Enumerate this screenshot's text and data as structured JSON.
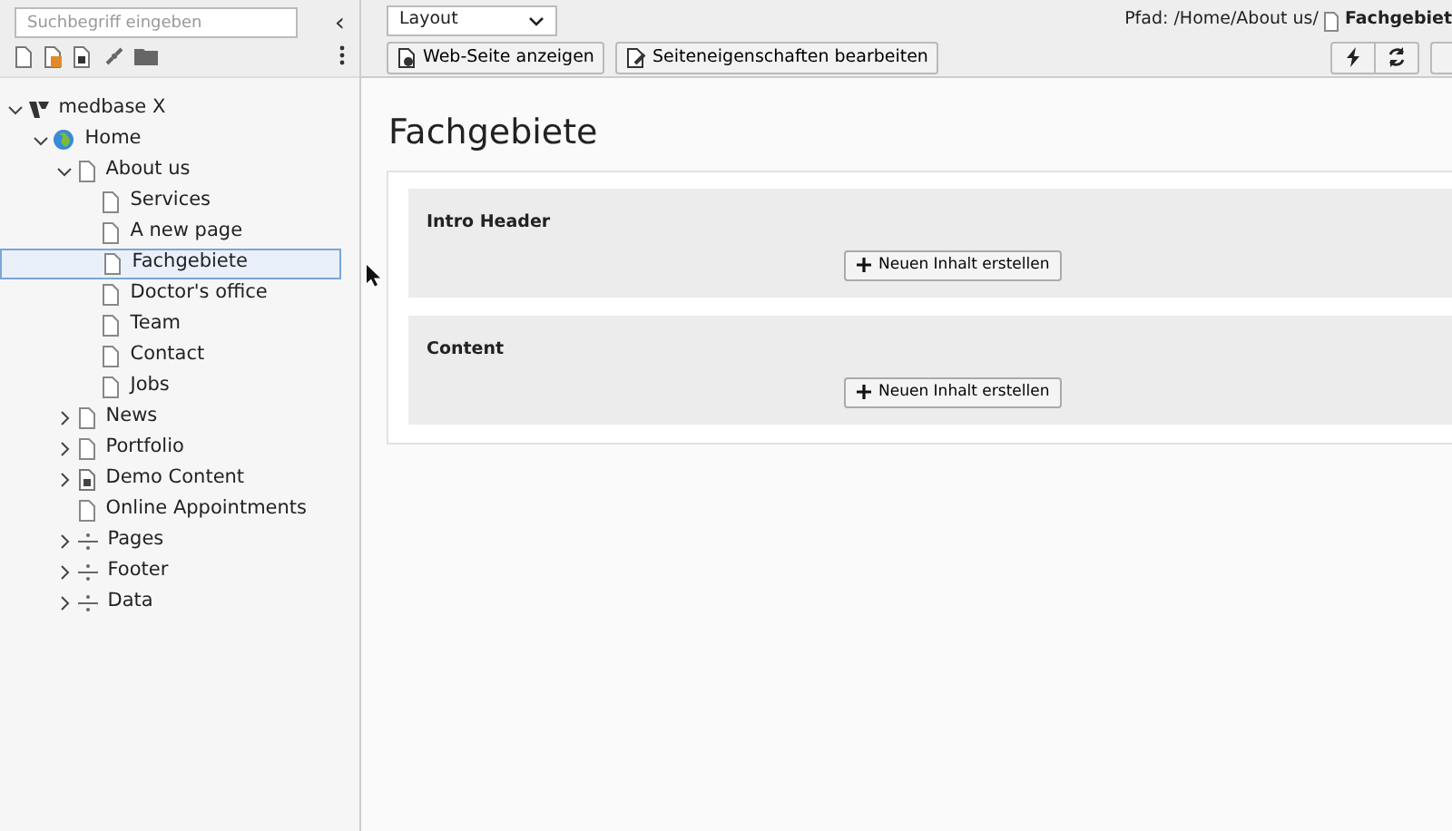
{
  "sidebar": {
    "search": {
      "placeholder": "Suchbegriff eingeben"
    },
    "collapse_button": "‹",
    "tree": [
      {
        "label": "medbase X",
        "kind": "site",
        "expanded": true,
        "selected": false,
        "children": [
          {
            "label": "Home",
            "kind": "globe",
            "expanded": true,
            "selected": false,
            "children": [
              {
                "label": "About us",
                "kind": "page",
                "expanded": true,
                "selected": false,
                "children": [
                  {
                    "label": "Services",
                    "kind": "page",
                    "selected": false
                  },
                  {
                    "label": "A new page",
                    "kind": "page",
                    "selected": false
                  },
                  {
                    "label": "Fachgebiete",
                    "kind": "page",
                    "selected": true
                  },
                  {
                    "label": "Doctor's office",
                    "kind": "page",
                    "selected": false
                  },
                  {
                    "label": "Team",
                    "kind": "page",
                    "selected": false
                  },
                  {
                    "label": "Contact",
                    "kind": "page",
                    "selected": false
                  },
                  {
                    "label": "Jobs",
                    "kind": "page",
                    "selected": false
                  }
                ]
              },
              {
                "label": "News",
                "kind": "page",
                "expanded": false,
                "selected": false
              },
              {
                "label": "Portfolio",
                "kind": "page",
                "expanded": false,
                "selected": false
              },
              {
                "label": "Demo Content",
                "kind": "content",
                "expanded": false,
                "selected": false
              },
              {
                "label": "Online Appointments",
                "kind": "page",
                "selected": false
              },
              {
                "label": "Pages",
                "kind": "separator",
                "expanded": false,
                "selected": false
              },
              {
                "label": "Footer",
                "kind": "separator",
                "expanded": false,
                "selected": false
              },
              {
                "label": "Data",
                "kind": "separator",
                "expanded": false,
                "selected": false
              }
            ]
          }
        ]
      }
    ]
  },
  "toolbar": {
    "view_select": "Layout",
    "buttons": [
      "Web-Seite anzeigen",
      "Seiteneigenschaften bearbeiten"
    ],
    "path_label": "Pfad: /Home/About us/",
    "path_current": "Fachgebiet"
  },
  "page": {
    "title": "Fachgebiete",
    "sections": [
      {
        "title": "Intro Header",
        "button": "Neuen Inhalt erstellen"
      },
      {
        "title": "Content",
        "button": "Neuen Inhalt erstellen"
      }
    ]
  }
}
